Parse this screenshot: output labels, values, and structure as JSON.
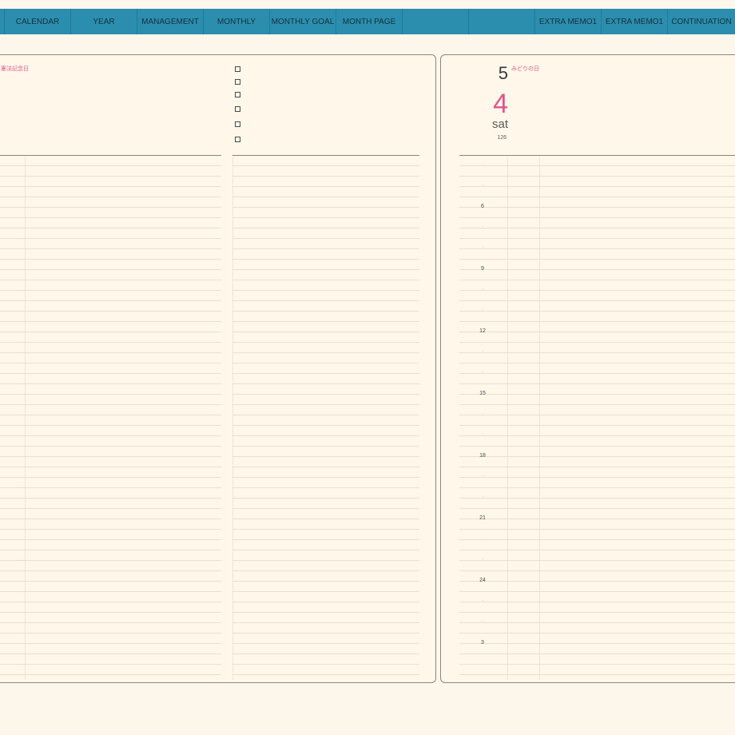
{
  "nav": {
    "tabs": [
      {
        "label": ""
      },
      {
        "label": "CALENDAR"
      },
      {
        "label": "YEAR"
      },
      {
        "label": "MANAGEMENT"
      },
      {
        "label": "MONTHLY"
      },
      {
        "label": "MONTHLY GOAL"
      },
      {
        "label": "MONTH PAGE"
      },
      {
        "label": ""
      },
      {
        "label": ""
      },
      {
        "label": "EXTRA MEMO1"
      },
      {
        "label": "EXTRA MEMO1"
      },
      {
        "label": "CONTINUATION"
      }
    ]
  },
  "left_page": {
    "holiday": "憲法記念日",
    "checkbox_count": 6
  },
  "right_page": {
    "month": "5",
    "day": "4",
    "weekday": "sat",
    "day_count": "126",
    "holiday": "みどりの日",
    "time_labels": [
      "·",
      "·",
      "6",
      "·",
      "·",
      "9",
      "·",
      "·",
      "12",
      "·",
      "·",
      "15",
      "·",
      "·",
      "18",
      "·",
      "·",
      "21",
      "·",
      "·",
      "24",
      "·",
      "·",
      "3"
    ]
  },
  "colors": {
    "nav": "#2b8eaf",
    "accent": "#e0558c",
    "paper": "#fdf6ea"
  }
}
